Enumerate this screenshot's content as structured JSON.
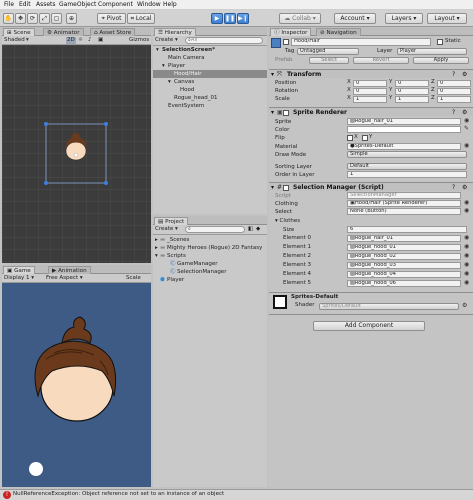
{
  "menu": [
    "File",
    "Edit",
    "Assets",
    "GameObject",
    "Component",
    "Window",
    "Help"
  ],
  "toolbar": {
    "pivot": "Pivot",
    "local": "Local",
    "collab": "Collab",
    "account": "Account",
    "layers": "Layers",
    "layout": "Layout"
  },
  "scene": {
    "tab_scene": "Scene",
    "tab_animator": "Animator",
    "tab_asset_store": "Asset Store",
    "shading": "Shaded",
    "mode": "2D",
    "gizmos": "Gizmos"
  },
  "hierarchy": {
    "tab": "Hierarchy",
    "create": "Create",
    "search_placeholder": "All",
    "items": [
      {
        "label": "SelectionScreen*",
        "indent": 0,
        "selected": false,
        "arrow": "down"
      },
      {
        "label": "Main Camera",
        "indent": 1,
        "selected": false,
        "arrow": ""
      },
      {
        "label": "Player",
        "indent": 1,
        "selected": false,
        "arrow": "down"
      },
      {
        "label": "Hood/Hair",
        "indent": 2,
        "selected": true,
        "arrow": ""
      },
      {
        "label": "Canvas",
        "indent": 2,
        "selected": false,
        "arrow": "down"
      },
      {
        "label": "Hood",
        "indent": 3,
        "selected": false,
        "arrow": ""
      },
      {
        "label": "Rogue_head_01",
        "indent": 2,
        "selected": false,
        "arrow": ""
      },
      {
        "label": "EventSystem",
        "indent": 1,
        "selected": false,
        "arrow": ""
      }
    ]
  },
  "project": {
    "tab": "Project",
    "create": "Create",
    "items": [
      {
        "label": "_Scenes",
        "indent": 0,
        "arrow": "right",
        "icon": "folder"
      },
      {
        "label": "Mighty Heroes (Rogue) 2D Fantasy",
        "indent": 0,
        "arrow": "right",
        "icon": "folder"
      },
      {
        "label": "Scripts",
        "indent": 0,
        "arrow": "down",
        "icon": "folder"
      },
      {
        "label": "GameManager",
        "indent": 1,
        "arrow": "",
        "icon": "script"
      },
      {
        "label": "SelectionManager",
        "indent": 1,
        "arrow": "",
        "icon": "script"
      },
      {
        "label": "Player",
        "indent": 0,
        "arrow": "",
        "icon": "prefab"
      }
    ]
  },
  "game": {
    "tab_game": "Game",
    "tab_animation": "Animation",
    "display": "Display 1",
    "aspect": "Free Aspect",
    "scale": "Scale"
  },
  "inspector": {
    "tab_inspector": "Inspector",
    "tab_navigation": "Navigation",
    "object_name": "Hood/Hair",
    "static_label": "Static",
    "tag_label": "Tag",
    "tag_value": "Untagged",
    "layer_label": "Layer",
    "layer_value": "Player",
    "prefab_label": "Prefab",
    "select": "Select",
    "revert": "Revert",
    "apply": "Apply",
    "transform": {
      "title": "Transform",
      "rows": [
        {
          "label": "Position",
          "x": "0",
          "y": "0",
          "z": "0"
        },
        {
          "label": "Rotation",
          "x": "0",
          "y": "0",
          "z": "0"
        },
        {
          "label": "Scale",
          "x": "1",
          "y": "1",
          "z": "1"
        }
      ]
    },
    "sprite_renderer": {
      "title": "Sprite Renderer",
      "sprite_label": "Sprite",
      "sprite_value": "Rogue_hair_01",
      "color_label": "Color",
      "flip_label": "Flip",
      "flip_x": "X",
      "flip_y": "Y",
      "material_label": "Material",
      "material_value": "Sprites-Default",
      "draw_mode_label": "Draw Mode",
      "draw_mode_value": "Simple",
      "sorting_layer_label": "Sorting Layer",
      "sorting_layer_value": "Default",
      "order_label": "Order in Layer",
      "order_value": "1"
    },
    "selection_manager": {
      "title": "Selection Manager (Script)",
      "script_label": "Script",
      "script_value": "SelectionManager",
      "clothing_label": "Clothing",
      "clothing_value": "Hood/Hair (Sprite Renderer)",
      "select_label": "Select",
      "select_value": "None (Button)",
      "clothes_label": "Clothes",
      "size_label": "Size",
      "size_value": "6",
      "elements": [
        {
          "label": "Element 0",
          "value": "Rogue_hair_01"
        },
        {
          "label": "Element 1",
          "value": "Rogue_hood_01"
        },
        {
          "label": "Element 2",
          "value": "Rogue_hood_02"
        },
        {
          "label": "Element 3",
          "value": "Rogue_hood_03"
        },
        {
          "label": "Element 4",
          "value": "Rogue_hood_04"
        },
        {
          "label": "Element 5",
          "value": "Rogue_hood_06"
        }
      ]
    },
    "material_panel": {
      "title": "Sprites-Default",
      "shader_label": "Shader",
      "shader_value": "Sprites/Default"
    },
    "add_component": "Add Component"
  },
  "status": {
    "message": "NullReferenceException: Object reference not set to an instance of an object"
  },
  "colors": {
    "selection": "#8a8a8a",
    "game_bg": "#3e5b85",
    "scene_bg": "#3c3c3c",
    "play_blue": "#3f7fd0",
    "error_red": "#cc2222"
  }
}
